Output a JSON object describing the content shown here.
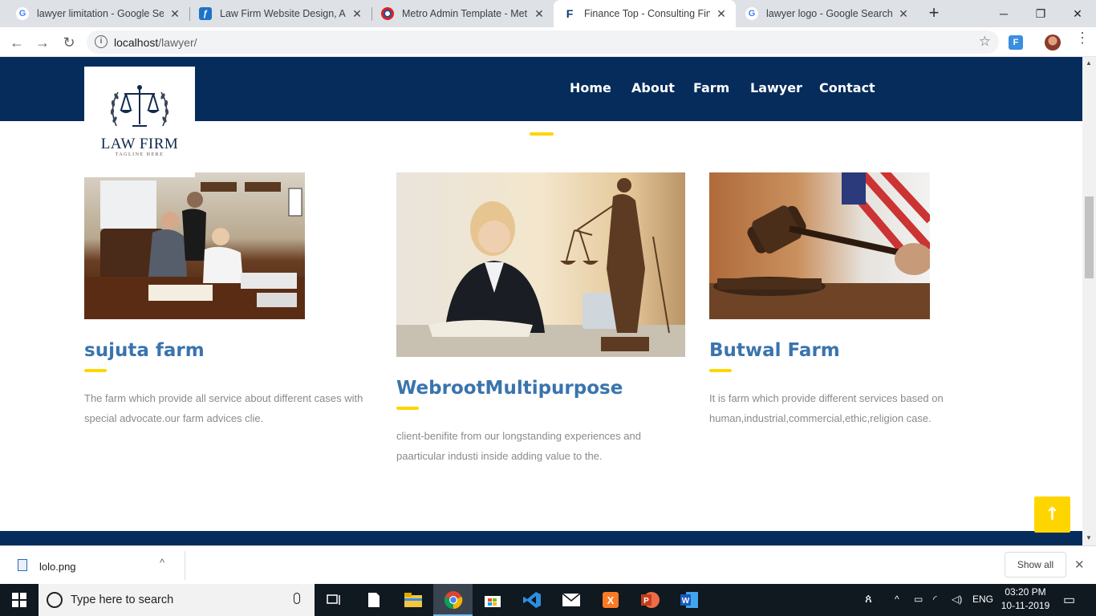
{
  "browser": {
    "tabs": [
      {
        "title": "lawyer limitation - Google Search",
        "icon": "google-icon",
        "active": false
      },
      {
        "title": "Law Firm Website Design, Attorney",
        "icon": "site-icon",
        "active": false
      },
      {
        "title": "Metro Admin Template - Metro",
        "icon": "captain-shield-icon",
        "active": false
      },
      {
        "title": "Finance Top - Consulting Finance",
        "icon": "finance-icon",
        "active": true
      },
      {
        "title": "lawyer logo - Google Search",
        "icon": "google-icon",
        "active": false
      }
    ],
    "url_host": "localhost",
    "url_path": "/lawyer/"
  },
  "site": {
    "logo": {
      "name": "LAW FIRM",
      "tagline": "TAGLINE HERE"
    },
    "nav": [
      "Home",
      "About",
      "Farm",
      "Lawyer",
      "Contact"
    ],
    "cards": [
      {
        "title": "sujuta farm",
        "text": "The farm which provide all service about different cases with special advocate.our farm advices clie."
      },
      {
        "title": "WebrootMultipurpose",
        "text": "client-benifite from our longstanding experiences and paarticular industi inside adding value to the."
      },
      {
        "title": "Butwal Farm",
        "text": "It is farm which provide different services based on human,industrial,commercial,ethic,religion case."
      }
    ],
    "accent_color": "#ffd500",
    "nav_color": "#062c5c"
  },
  "downloads": {
    "file": "lolo.png",
    "show_all": "Show all"
  },
  "taskbar": {
    "search_placeholder": "Type here to search",
    "lang": "ENG",
    "time": "03:20 PM",
    "date": "10-11-2019"
  }
}
